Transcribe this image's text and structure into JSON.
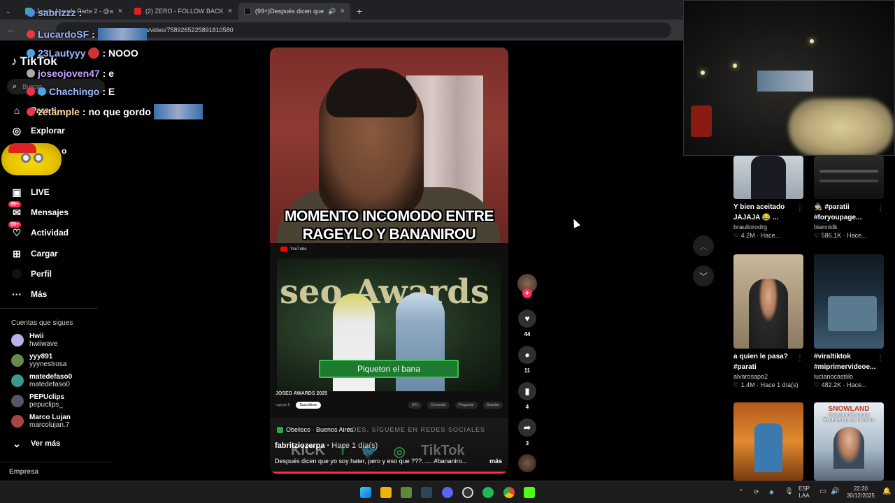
{
  "browser": {
    "tabs": [
      {
        "label": "Joseo Awards Parte 2 - @alitais",
        "close": "×"
      },
      {
        "label": "(2) ZERO - FOLLOW BACK - You",
        "close": "×"
      },
      {
        "label": "(99+)Después dicen que yo",
        "close": "×"
      }
    ],
    "new_tab": "+",
    "url": "tiktok.com/@fabritziozerpa/video/7589265225891810580",
    "url_visible": "pa/video/7589265225891810580"
  },
  "chat_overlay": [
    {
      "user": "sabrizzz",
      "text": ":"
    },
    {
      "user": "LucardoSF",
      "text": ":"
    },
    {
      "user": "23Lautyyy",
      "text": ": NOOO"
    },
    {
      "user": "joseojoven47",
      "text": ": e"
    },
    {
      "user": "Chachingo",
      "text": ": E"
    },
    {
      "user": "zetample",
      "text": ": no que gordo"
    },
    {
      "user": "",
      "text": "o"
    }
  ],
  "sidebar": {
    "logo": "TikTok",
    "search_placeholder": "Buscar",
    "items": [
      {
        "label": "Para ti",
        "icon": "home-icon"
      },
      {
        "label": "Explorar",
        "icon": "compass-icon"
      },
      {
        "label": "LIVE",
        "icon": "live-icon"
      },
      {
        "label": "Mensajes",
        "icon": "message-icon",
        "badge": "99+"
      },
      {
        "label": "Actividad",
        "icon": "activity-icon",
        "badge": "99+"
      },
      {
        "label": "Cargar",
        "icon": "upload-icon"
      },
      {
        "label": "Perfil",
        "icon": "profile-icon"
      },
      {
        "label": "Más",
        "icon": "more-icon"
      }
    ],
    "following_title": "Cuentas que sigues",
    "following": [
      {
        "name": "Hwii",
        "handle": "hwiiwave"
      },
      {
        "name": "yyy891",
        "handle": "yyynestrosa"
      },
      {
        "name": "matedefaso0",
        "handle": "matedefaso0"
      },
      {
        "name": "PEPUclips",
        "handle": "pepuclips_"
      },
      {
        "name": "Marco Lujan",
        "handle": "marcolujan.7"
      }
    ],
    "see_more": "Ver más",
    "footer": "Empresa"
  },
  "video": {
    "overlay_title_line1": "MOMENTO INCOMODO ENTRE",
    "overlay_title_line2": "RAGEYLO Y BANANIROU",
    "inner_subtitle": "Piqueton el bana",
    "inner_caption": "JOSEO AWARDS 2025",
    "inner_awards_text": "seo Awards",
    "inner_channel": "rageylo II",
    "inner_subscribe": "Suscribirse",
    "inner_like_count": "641",
    "inner_share": "Compartir",
    "inner_ask": "Preguntar",
    "inner_save": "Guardar",
    "watermark": "ADES. SÍGUEME EN REDES SOCIALES",
    "socials": [
      "KICK",
      "f",
      "🐦",
      "◎",
      "TikTok"
    ],
    "location": "Obelisco · Buenos Aires",
    "author": "fabritziozerpa",
    "posted": "Hace 1 día(s)",
    "description": "Después dicen que yo soy hater, pero y eso que ???.......#bananiro...",
    "more": "más"
  },
  "actions": {
    "likes": "44",
    "comments": "11",
    "saves": "4",
    "shares": "3"
  },
  "feed_cards": [
    {
      "title": "Y bien aceitado JAJAJA 😂 ...",
      "user": "brauliorodrg",
      "stats": "♡ 4.2M · Hace..."
    },
    {
      "title": "🧙 #paratii #foryoupage...",
      "user": "biannidk",
      "stats": "♡ 586.1K · Hace..."
    },
    {
      "title": "a quien le pasa? #parati",
      "user": "alvarosapo2",
      "stats": "♡ 1.4M · Hace 1 día(s)"
    },
    {
      "title": "#viraltiktok #miprimervideoe...",
      "user": "lucianocastiilo",
      "stats": "♡ 482.2K · Hace..."
    },
    {
      "title": "",
      "user": "",
      "stats": ""
    },
    {
      "title": "SNOWLAND",
      "user": "",
      "stats": ""
    }
  ],
  "snowland_caption": "Snowland Panamá Experiencia de invierno",
  "taskbar": {
    "lang_top": "ESP",
    "lang_bottom": "LAA",
    "time": "22:20",
    "date": "30/12/2025"
  },
  "colors": {
    "accent": "#fe2c55",
    "background": "#000000",
    "subtitle_green": "#1d7a2f"
  }
}
